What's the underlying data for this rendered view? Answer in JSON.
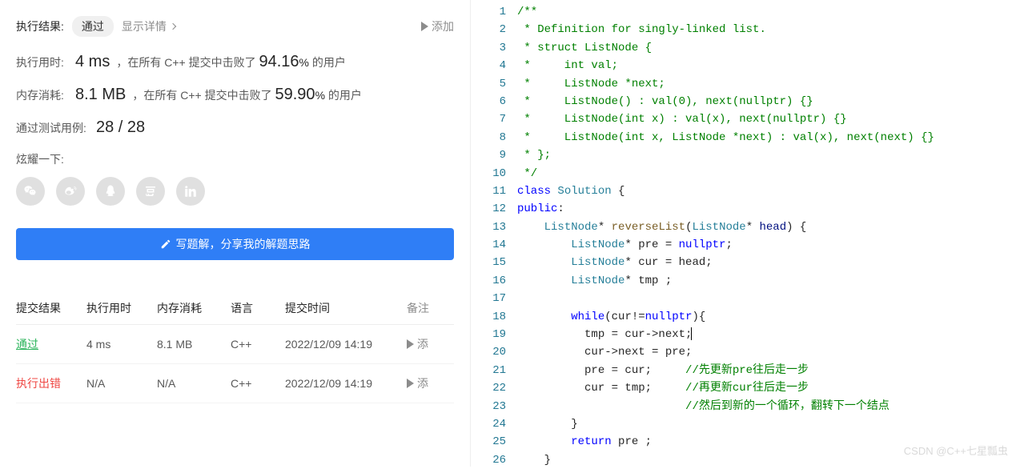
{
  "result": {
    "label": "执行结果:",
    "status": "通过",
    "details_link": "显示详情",
    "add_note": "添加"
  },
  "runtime": {
    "label": "执行用时:",
    "value": "4 ms",
    "desc_pre": "，在所有 C++ 提交中击败了",
    "percent": "94.16",
    "percent_sym": "%",
    "desc_post": "的用户"
  },
  "memory": {
    "label": "内存消耗:",
    "value": "8.1 MB",
    "desc_pre": "，在所有 C++ 提交中击败了",
    "percent": "59.90",
    "percent_sym": "%",
    "desc_post": "的用户"
  },
  "testcases": {
    "label": "通过测试用例:",
    "value": "28 / 28"
  },
  "share_label": "炫耀一下:",
  "write_button": "写题解，分享我的解题思路",
  "submissions": {
    "headers": {
      "result": "提交结果",
      "time": "执行用时",
      "mem": "内存消耗",
      "lang": "语言",
      "date": "提交时间",
      "note": "备注"
    },
    "rows": [
      {
        "result": "通过",
        "result_class": "pass",
        "time": "4 ms",
        "mem": "8.1 MB",
        "lang": "C++",
        "date": "2022/12/09 14:19",
        "note": "添"
      },
      {
        "result": "执行出错",
        "result_class": "error",
        "time": "N/A",
        "mem": "N/A",
        "lang": "C++",
        "date": "2022/12/09 14:19",
        "note": "添"
      }
    ]
  },
  "code": {
    "lines": [
      {
        "n": 1,
        "html": "<span class='cmt'>/**</span>"
      },
      {
        "n": 2,
        "html": "<span class='cmt'> * Definition for singly-linked list.</span>"
      },
      {
        "n": 3,
        "html": "<span class='cmt'> * struct ListNode {</span>"
      },
      {
        "n": 4,
        "html": "<span class='cmt'> *     int val;</span>"
      },
      {
        "n": 5,
        "html": "<span class='cmt'> *     ListNode *next;</span>"
      },
      {
        "n": 6,
        "html": "<span class='cmt'> *     ListNode() : val(0), next(nullptr) {}</span>"
      },
      {
        "n": 7,
        "html": "<span class='cmt'> *     ListNode(int x) : val(x), next(nullptr) {}</span>"
      },
      {
        "n": 8,
        "html": "<span class='cmt'> *     ListNode(int x, ListNode *next) : val(x), next(next) {}</span>"
      },
      {
        "n": 9,
        "html": "<span class='cmt'> * };</span>"
      },
      {
        "n": 10,
        "html": "<span class='cmt'> */</span>"
      },
      {
        "n": 11,
        "html": "<span class='kw'>class</span> <span class='type'>Solution</span> {"
      },
      {
        "n": 12,
        "html": "<span class='kw'>public</span>:"
      },
      {
        "n": 13,
        "html": "    <span class='type'>ListNode</span>* <span class='fn'>reverseList</span>(<span class='type'>ListNode</span>* <span class='param'>head</span>) {"
      },
      {
        "n": 14,
        "html": "        <span class='type'>ListNode</span>* pre = <span class='str-const'>nullptr</span>;"
      },
      {
        "n": 15,
        "html": "        <span class='type'>ListNode</span>* cur = head;"
      },
      {
        "n": 16,
        "html": "        <span class='type'>ListNode</span>* tmp ;"
      },
      {
        "n": 17,
        "html": ""
      },
      {
        "n": 18,
        "html": "        <span class='kw'>while</span>(cur!=<span class='str-const'>nullptr</span>){"
      },
      {
        "n": 19,
        "html": "          tmp = cur-&gt;next;<span class='cursor-bar'></span>"
      },
      {
        "n": 20,
        "html": "          cur-&gt;next = pre;"
      },
      {
        "n": 21,
        "html": "          pre = cur;     <span class='cmt'>//先更新pre往后走一步</span>"
      },
      {
        "n": 22,
        "html": "          cur = tmp;     <span class='cmt'>//再更新cur往后走一步</span>"
      },
      {
        "n": 23,
        "html": "                         <span class='cmt'>//然后到新的一个循环，翻转下一个结点</span>"
      },
      {
        "n": 24,
        "html": "        }"
      },
      {
        "n": 25,
        "html": "        <span class='kw'>return</span> pre ;"
      },
      {
        "n": 26,
        "html": "    }"
      }
    ]
  },
  "watermark": "CSDN @C++七星瓢虫"
}
